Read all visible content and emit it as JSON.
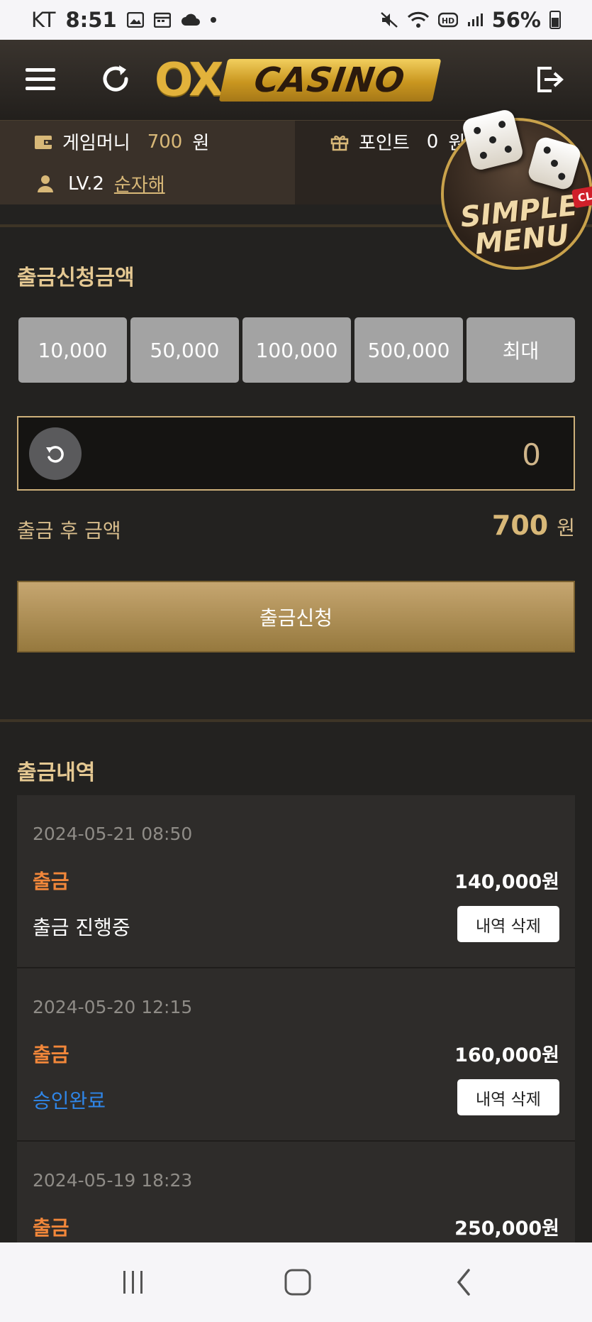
{
  "status_bar": {
    "carrier": "KT",
    "time": "8:51",
    "battery": "56%"
  },
  "header": {
    "logo_ox": "OX",
    "logo_casino": "CASINO"
  },
  "account": {
    "money_label": "게임머니",
    "money_value": "700",
    "money_unit": "원",
    "point_label": "포인트",
    "point_value": "0",
    "point_unit": "원",
    "level": "LV.2",
    "username": "순자해"
  },
  "simple_menu": {
    "line1": "SIMPLE",
    "line2": "MENU",
    "badge": "CLI"
  },
  "withdraw": {
    "title": "출금신청금액",
    "amount_buttons": [
      "10,000",
      "50,000",
      "100,000",
      "500,000",
      "최대"
    ],
    "amount_value": "0",
    "after_label": "출금 후 금액",
    "after_value": "700",
    "after_unit": "원",
    "submit_label": "출금신청"
  },
  "history": {
    "title": "출금내역",
    "items": [
      {
        "date": "2024-05-21 08:50",
        "type": "출금",
        "amount": "140,000원",
        "status": "출금 진행중",
        "delete_label": "내역 삭제"
      },
      {
        "date": "2024-05-20 12:15",
        "type": "출금",
        "amount": "160,000원",
        "status": "승인완료",
        "delete_label": "내역 삭제"
      },
      {
        "date": "2024-05-19 18:23",
        "type": "출금",
        "amount": "250,000원",
        "status": "",
        "delete_label": ""
      }
    ]
  },
  "colors": {
    "accent_gold": "#d8b878",
    "withdraw_orange": "#f2873a",
    "approved_blue": "#2f86e8"
  }
}
